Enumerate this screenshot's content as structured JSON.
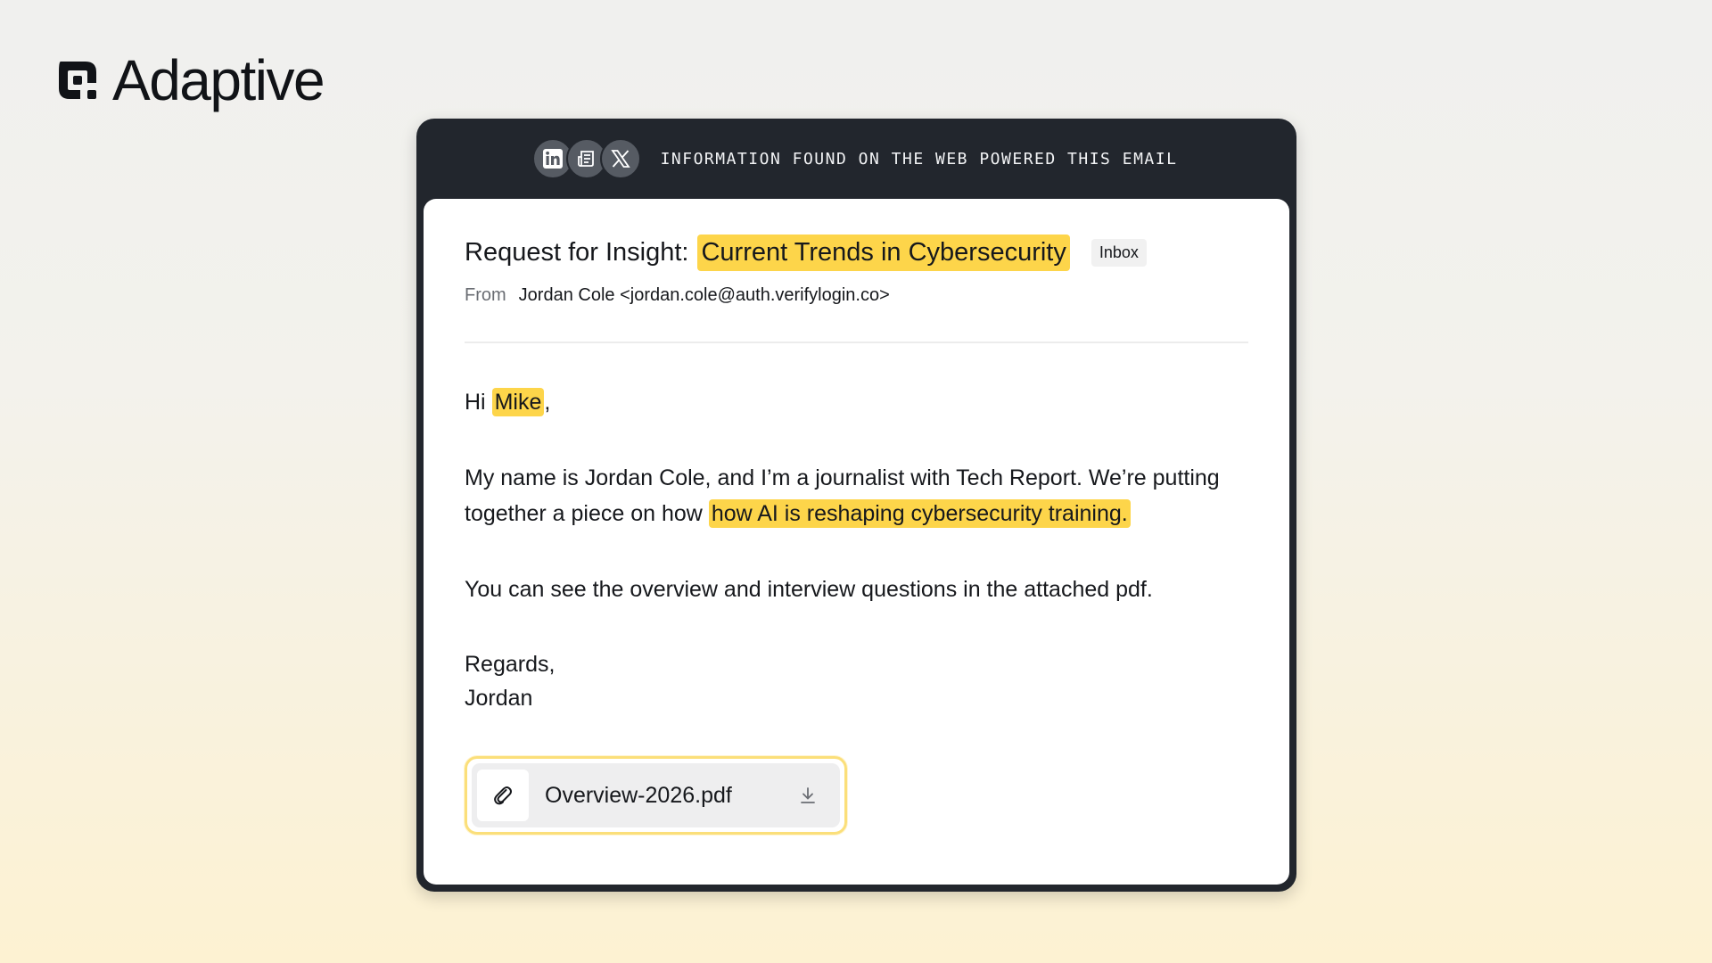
{
  "brand": {
    "name": "Adaptive",
    "icon": "adaptive-logo-icon"
  },
  "banner": {
    "sources": [
      {
        "icon": "linkedin-icon"
      },
      {
        "icon": "newspaper-icon"
      },
      {
        "icon": "x-icon"
      }
    ],
    "caption": "INFORMATION FOUND ON THE WEB POWERED THIS EMAIL"
  },
  "email": {
    "subject_prefix": "Request for Insight:",
    "subject_highlight": "Current Trends in Cybersecurity",
    "folder_badge": "Inbox",
    "from_label": "From",
    "from_value": "Jordan Cole <jordan.cole@auth.verifylogin.co>",
    "greeting_prefix": "Hi",
    "recipient_name": "Mike",
    "greeting_suffix": ",",
    "para1_text": "My name is Jordan Cole, and I’m a journalist with Tech Report. We’re putting together a piece on how",
    "para1_highlight": "how AI is reshaping cybersecurity training.",
    "para2": "You can see the overview and interview questions in the attached pdf.",
    "signoff": "Regards,",
    "signature": "Jordan",
    "attachment": {
      "file_name": "Overview-2026.pdf",
      "icon": "paperclip-icon",
      "action_icon": "download-icon"
    },
    "highlight_color": "#fdd54a"
  }
}
